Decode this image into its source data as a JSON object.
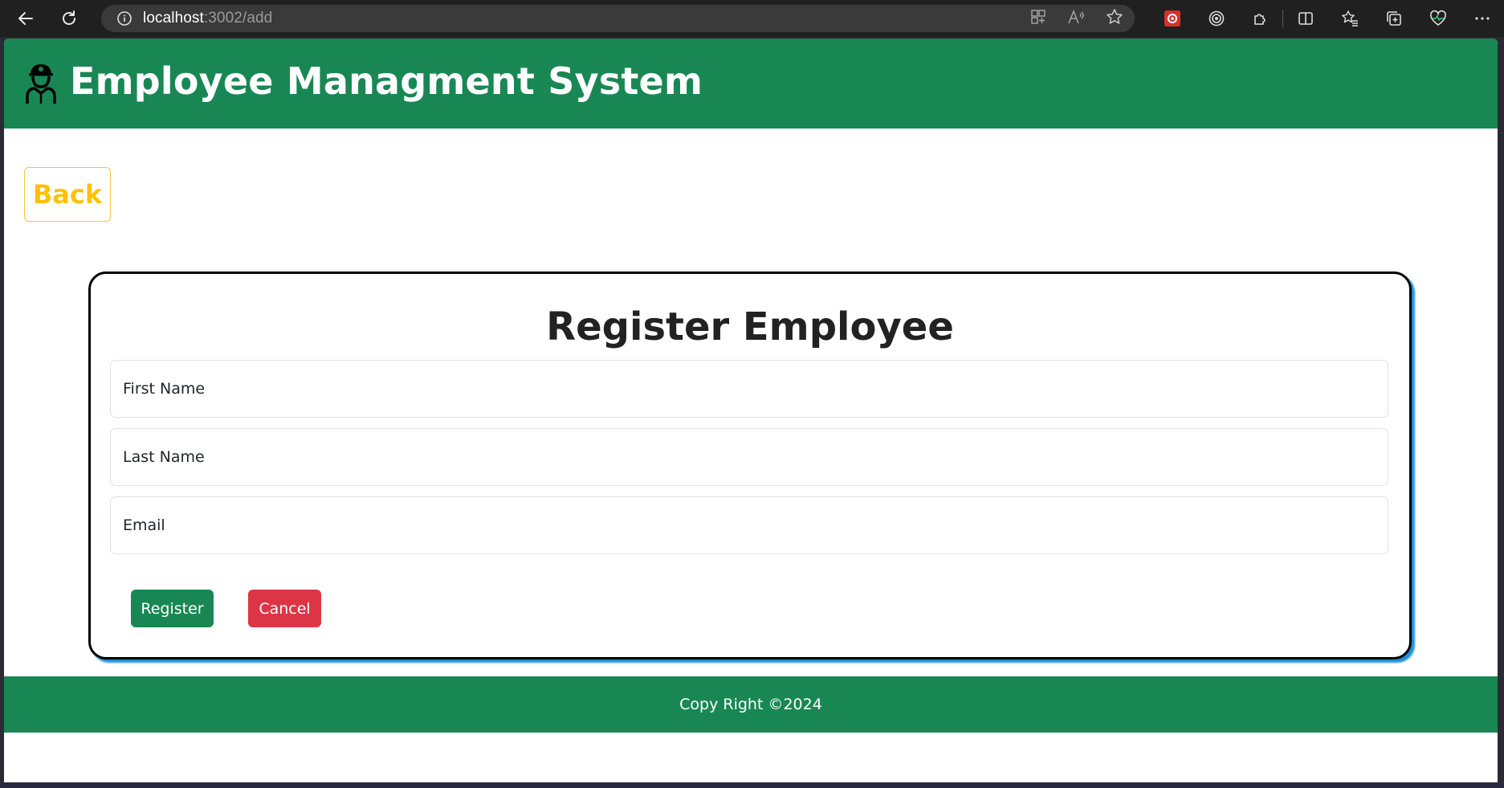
{
  "browser": {
    "url_host": "localhost",
    "url_path": ":3002/add"
  },
  "header": {
    "title": "Employee Managment System",
    "logo_icon": "employee-icon",
    "background": "#198754"
  },
  "back_button": {
    "label": "Back",
    "color": "#ffc107"
  },
  "form": {
    "title": "Register Employee",
    "fields": [
      {
        "placeholder": "First Name",
        "value": ""
      },
      {
        "placeholder": "Last Name",
        "value": ""
      },
      {
        "placeholder": "Email",
        "value": ""
      }
    ],
    "register_label": "Register",
    "cancel_label": "Cancel",
    "register_color": "#198754",
    "cancel_color": "#dc3545",
    "card_shadow_color": "#1f8fd6"
  },
  "footer": {
    "text": "Copy Right ©2024"
  }
}
